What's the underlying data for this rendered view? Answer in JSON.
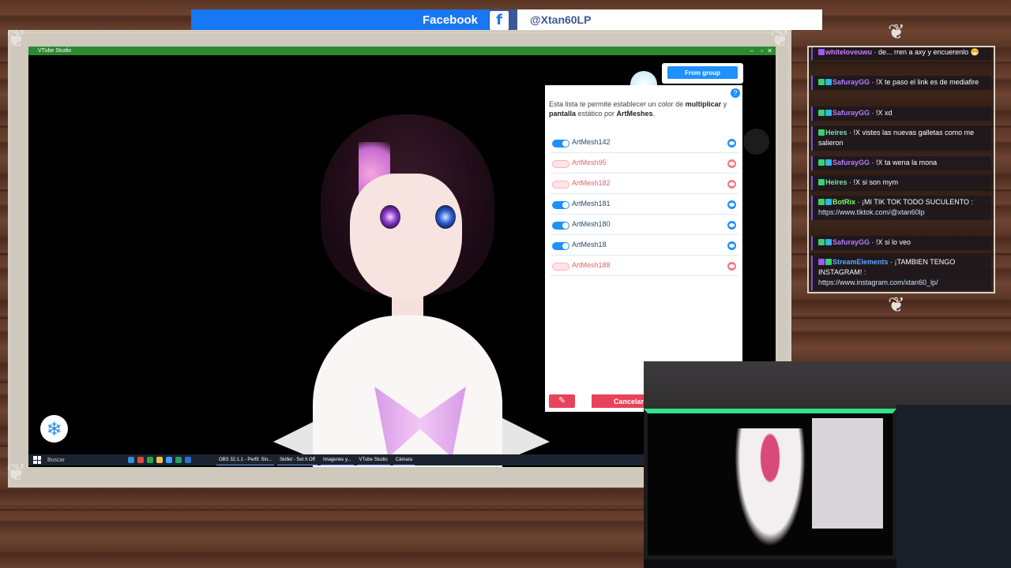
{
  "banner": {
    "platform": "Facebook",
    "icon": "f",
    "handle": "@Xtan60LP",
    "colors": {
      "facebook_blue": "#1877f2",
      "icon_bg": "#3b5998"
    }
  },
  "window": {
    "title": "VTube Studio",
    "controls": [
      "–",
      "▫",
      "✕"
    ]
  },
  "panel": {
    "from_group_label": "From group",
    "help": "?",
    "description_parts": [
      "Esta lista te permite establecer un color de ",
      "multiplicar",
      " y ",
      "pantalla",
      " estático por ",
      "ArtMeshes",
      "."
    ],
    "meshes": [
      {
        "name": "ArtMesh142",
        "enabled": true
      },
      {
        "name": "ArtMesh95",
        "enabled": false
      },
      {
        "name": "ArtMesh182",
        "enabled": false
      },
      {
        "name": "ArtMesh181",
        "enabled": true
      },
      {
        "name": "ArtMesh180",
        "enabled": true
      },
      {
        "name": "ArtMesh18",
        "enabled": true
      },
      {
        "name": "ArtMesh188",
        "enabled": false
      }
    ],
    "cancel_label": "Cancelar",
    "icon_button": "brush-icon",
    "colors": {
      "accent_blue": "#1e90ff",
      "danger_red": "#e8435a",
      "off_label": "#e4606d"
    }
  },
  "taskbar": {
    "search_label": "Buscar",
    "apps": [
      "OBS 32.1.1 - Perfil: Sin...",
      "Skillet - Set It Off",
      "Imagenes y...",
      "VTube Studio",
      "Cámara"
    ]
  },
  "chat": {
    "messages": [
      {
        "user": "whiteloveuwu",
        "text": "· de... rren a axy y encuerenlo 😁",
        "color": "#c77dff"
      },
      {
        "user": "SafurayGG",
        "text": "· !X te paso el link es de mediafire",
        "color": "#b57bff"
      },
      {
        "user": "SafurayGG",
        "text": "· !X xd",
        "color": "#b57bff"
      },
      {
        "user": "Heires",
        "text": "· !X vistes las nuevas galletas como me salieron",
        "color": "#7fe0b0"
      },
      {
        "user": "SafurayGG",
        "text": "· !X ta wena la mona",
        "color": "#b57bff"
      },
      {
        "user": "Heires",
        "text": "· !X si son mym",
        "color": "#7fe0b0"
      },
      {
        "user": "BotRix",
        "text": "· ¡MI TIK TOK TODO SUCULENTO :",
        "link": "https://www.tiktok.com/@xtan60lp",
        "color": "#7cff6a"
      },
      {
        "user": "SafurayGG",
        "text": "· !X si lo veo",
        "color": "#b57bff"
      },
      {
        "user": "StreamElements",
        "text": "· ¡TAMBIEN TENGO INSTAGRAM! :",
        "link": "https://www.instagram.com/xtan60_lp/",
        "color": "#5aa7ff"
      }
    ]
  }
}
